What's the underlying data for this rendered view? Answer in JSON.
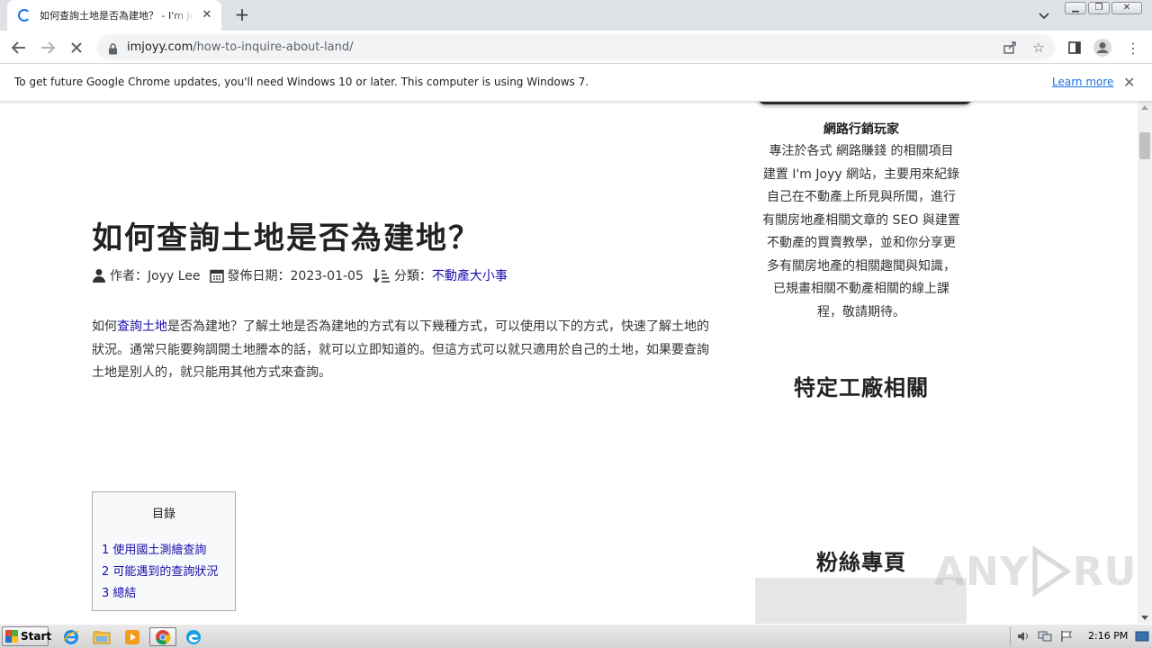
{
  "browser": {
    "tab_title": "如何查詢土地是否為建地？ - I'm Joyy",
    "url_domain": "imjoyy.com",
    "url_path": "/how-to-inquire-about-land/",
    "infobar_message": "To get future Google Chrome updates, you'll need Windows 10 or later. This computer is using Windows 7.",
    "infobar_link": "Learn more"
  },
  "article": {
    "title": "如何查詢土地是否為建地？",
    "author_label": "作者：Joyy Lee",
    "date_label": "發佈日期：2023-01-05",
    "category_label": "分類：",
    "category_link": "不動產大小事",
    "intro_prefix": "如何",
    "intro_link": "查詢土地",
    "intro_rest": "是否為建地？了解土地是否為建地的方式有以下幾種方式，可以使用以下的方式，快速了解土地的狀況。通常只能要夠調閱土地謄本的話，就可以立即知道的。但這方式可以就只適用於自己的土地，如果要查詢土地是別人的，就只能用其他方式來查詢。",
    "toc": {
      "title": "目錄",
      "items": [
        "1 使用國土測繪查詢",
        "2 可能遇到的查詢狀況",
        "3 總結"
      ]
    }
  },
  "sidebar": {
    "author_name": "網路行銷玩家",
    "bio_lines": [
      "專注於各式 網路賺錢 的相關項目",
      "建置 I'm Joyy 網站，主要用來紀錄",
      "自己在不動產上所見與所聞，進行",
      "有關房地產相關文章的 SEO 與建置",
      "不動產的買賣教學，並和你分享更",
      "多有關房地產的相關趣聞與知識，",
      "已規畫相關不動產相關的線上課",
      "程，敬請期待。"
    ],
    "heading_factory": "特定工廠相關",
    "heading_fans": "粉絲專頁"
  },
  "watermark": {
    "left": "ANY",
    "right": "RUN"
  },
  "taskbar": {
    "start_label": "Start",
    "clock": "2:16 PM"
  }
}
